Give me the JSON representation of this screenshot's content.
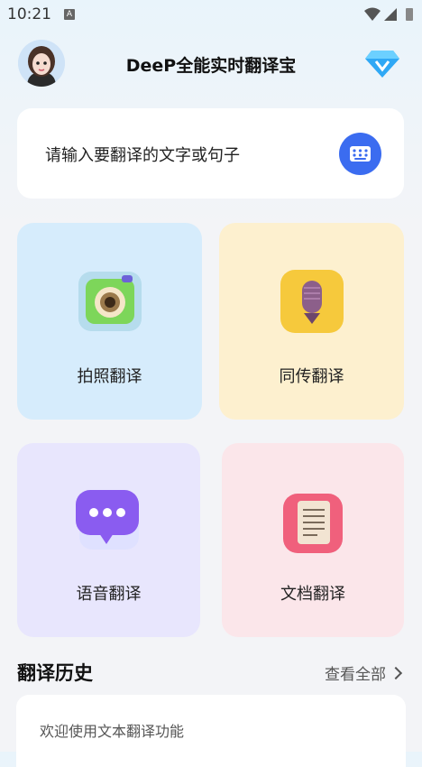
{
  "status_bar": {
    "time": "10:21",
    "notification_icon": "A"
  },
  "header": {
    "title": "DeeP全能实时翻译宝",
    "avatar": "user-avatar",
    "vip": "diamond-icon"
  },
  "search": {
    "placeholder": "请输入要翻译的文字或句子",
    "keyboard_icon": "keyboard-icon"
  },
  "features": [
    {
      "label": "拍照翻译",
      "icon": "camera-icon",
      "color": "#d6ecfc"
    },
    {
      "label": "同传翻译",
      "icon": "microphone-icon",
      "color": "#fdf0cf"
    },
    {
      "label": "语音翻译",
      "icon": "chat-bubble-icon",
      "color": "#e8e6fd"
    },
    {
      "label": "文档翻译",
      "icon": "document-icon",
      "color": "#fbe6ea"
    }
  ],
  "history": {
    "title": "翻译历史",
    "view_all": "查看全部",
    "items": [
      "欢迎使用文本翻译功能"
    ]
  }
}
